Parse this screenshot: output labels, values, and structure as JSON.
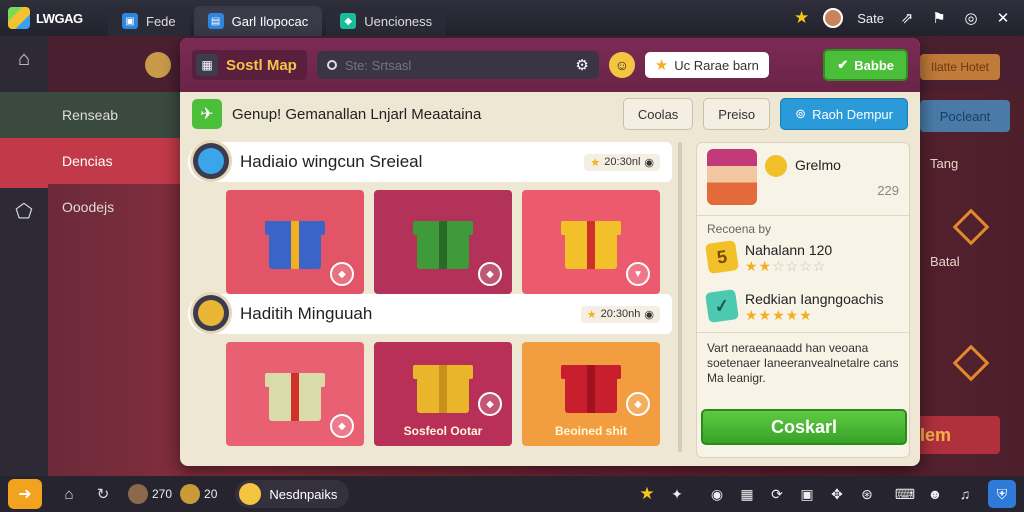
{
  "topbar": {
    "logo_text": "LWGAG",
    "tabs": [
      {
        "label": "Fede",
        "icon": "app-tab-icon"
      },
      {
        "label": "Garl Ilopocac",
        "icon": "book-icon"
      },
      {
        "label": "Uencioness",
        "icon": "puzzle-icon"
      }
    ],
    "user_label": "Sate"
  },
  "background": {
    "sidebar_items": [
      "Renseab",
      "Dencias",
      "Ooodejs"
    ],
    "top_right_button": "Ilatte Hotet",
    "right_button": "Pocleant",
    "right_text_1": "Tang",
    "right_text_2": "Batal",
    "right_red_text": "Iem"
  },
  "modal": {
    "title": "Sostl Map",
    "search": {
      "placeholder": "Ste: Srtsasl",
      "value": ""
    },
    "stars_badge": "Uc Rarae barn",
    "green_button": "Babbe",
    "subheader": {
      "title": "Genup! Gemanallan Lnjarl Meaataina",
      "btn_1": "Coolas",
      "btn_2": "Preiso",
      "btn_3": "Raoh Dempur"
    },
    "sections": [
      {
        "title": "Hadiaio wingcun Sreieal",
        "time": "20:30nl",
        "cards": [
          {
            "gift": "blue-briefcase-gift",
            "label": ""
          },
          {
            "gift": "green-gift",
            "label": ""
          },
          {
            "gift": "gold-gift",
            "label": ""
          }
        ]
      },
      {
        "title": "Haditih Minguuah",
        "time": "20:30nh",
        "cards": [
          {
            "gift": "white-red-ribbon-gift",
            "label": ""
          },
          {
            "gift": "yellow-gift",
            "label": "Sosfeol Ootar"
          },
          {
            "gift": "red-box-gift",
            "label": "Beoined shit"
          }
        ]
      }
    ],
    "side_panel": {
      "name": "Grelmo",
      "count": "229",
      "section_label": "Recoena by",
      "items": [
        {
          "badge": "5",
          "title": "Nahalann 120",
          "rating": 2.5
        },
        {
          "badge": "✓",
          "title": "Redkian Iangngoachis",
          "rating": 5
        }
      ],
      "description": "Vart neraeanaadd han veoana soetenaer Ianeeranvealnetalre cans Ma leanigr.",
      "cta": "Coskarl"
    }
  },
  "bottombar": {
    "user_1_count": "270",
    "user_2_count": "20",
    "chat_label": "Nesdnpaiks"
  }
}
